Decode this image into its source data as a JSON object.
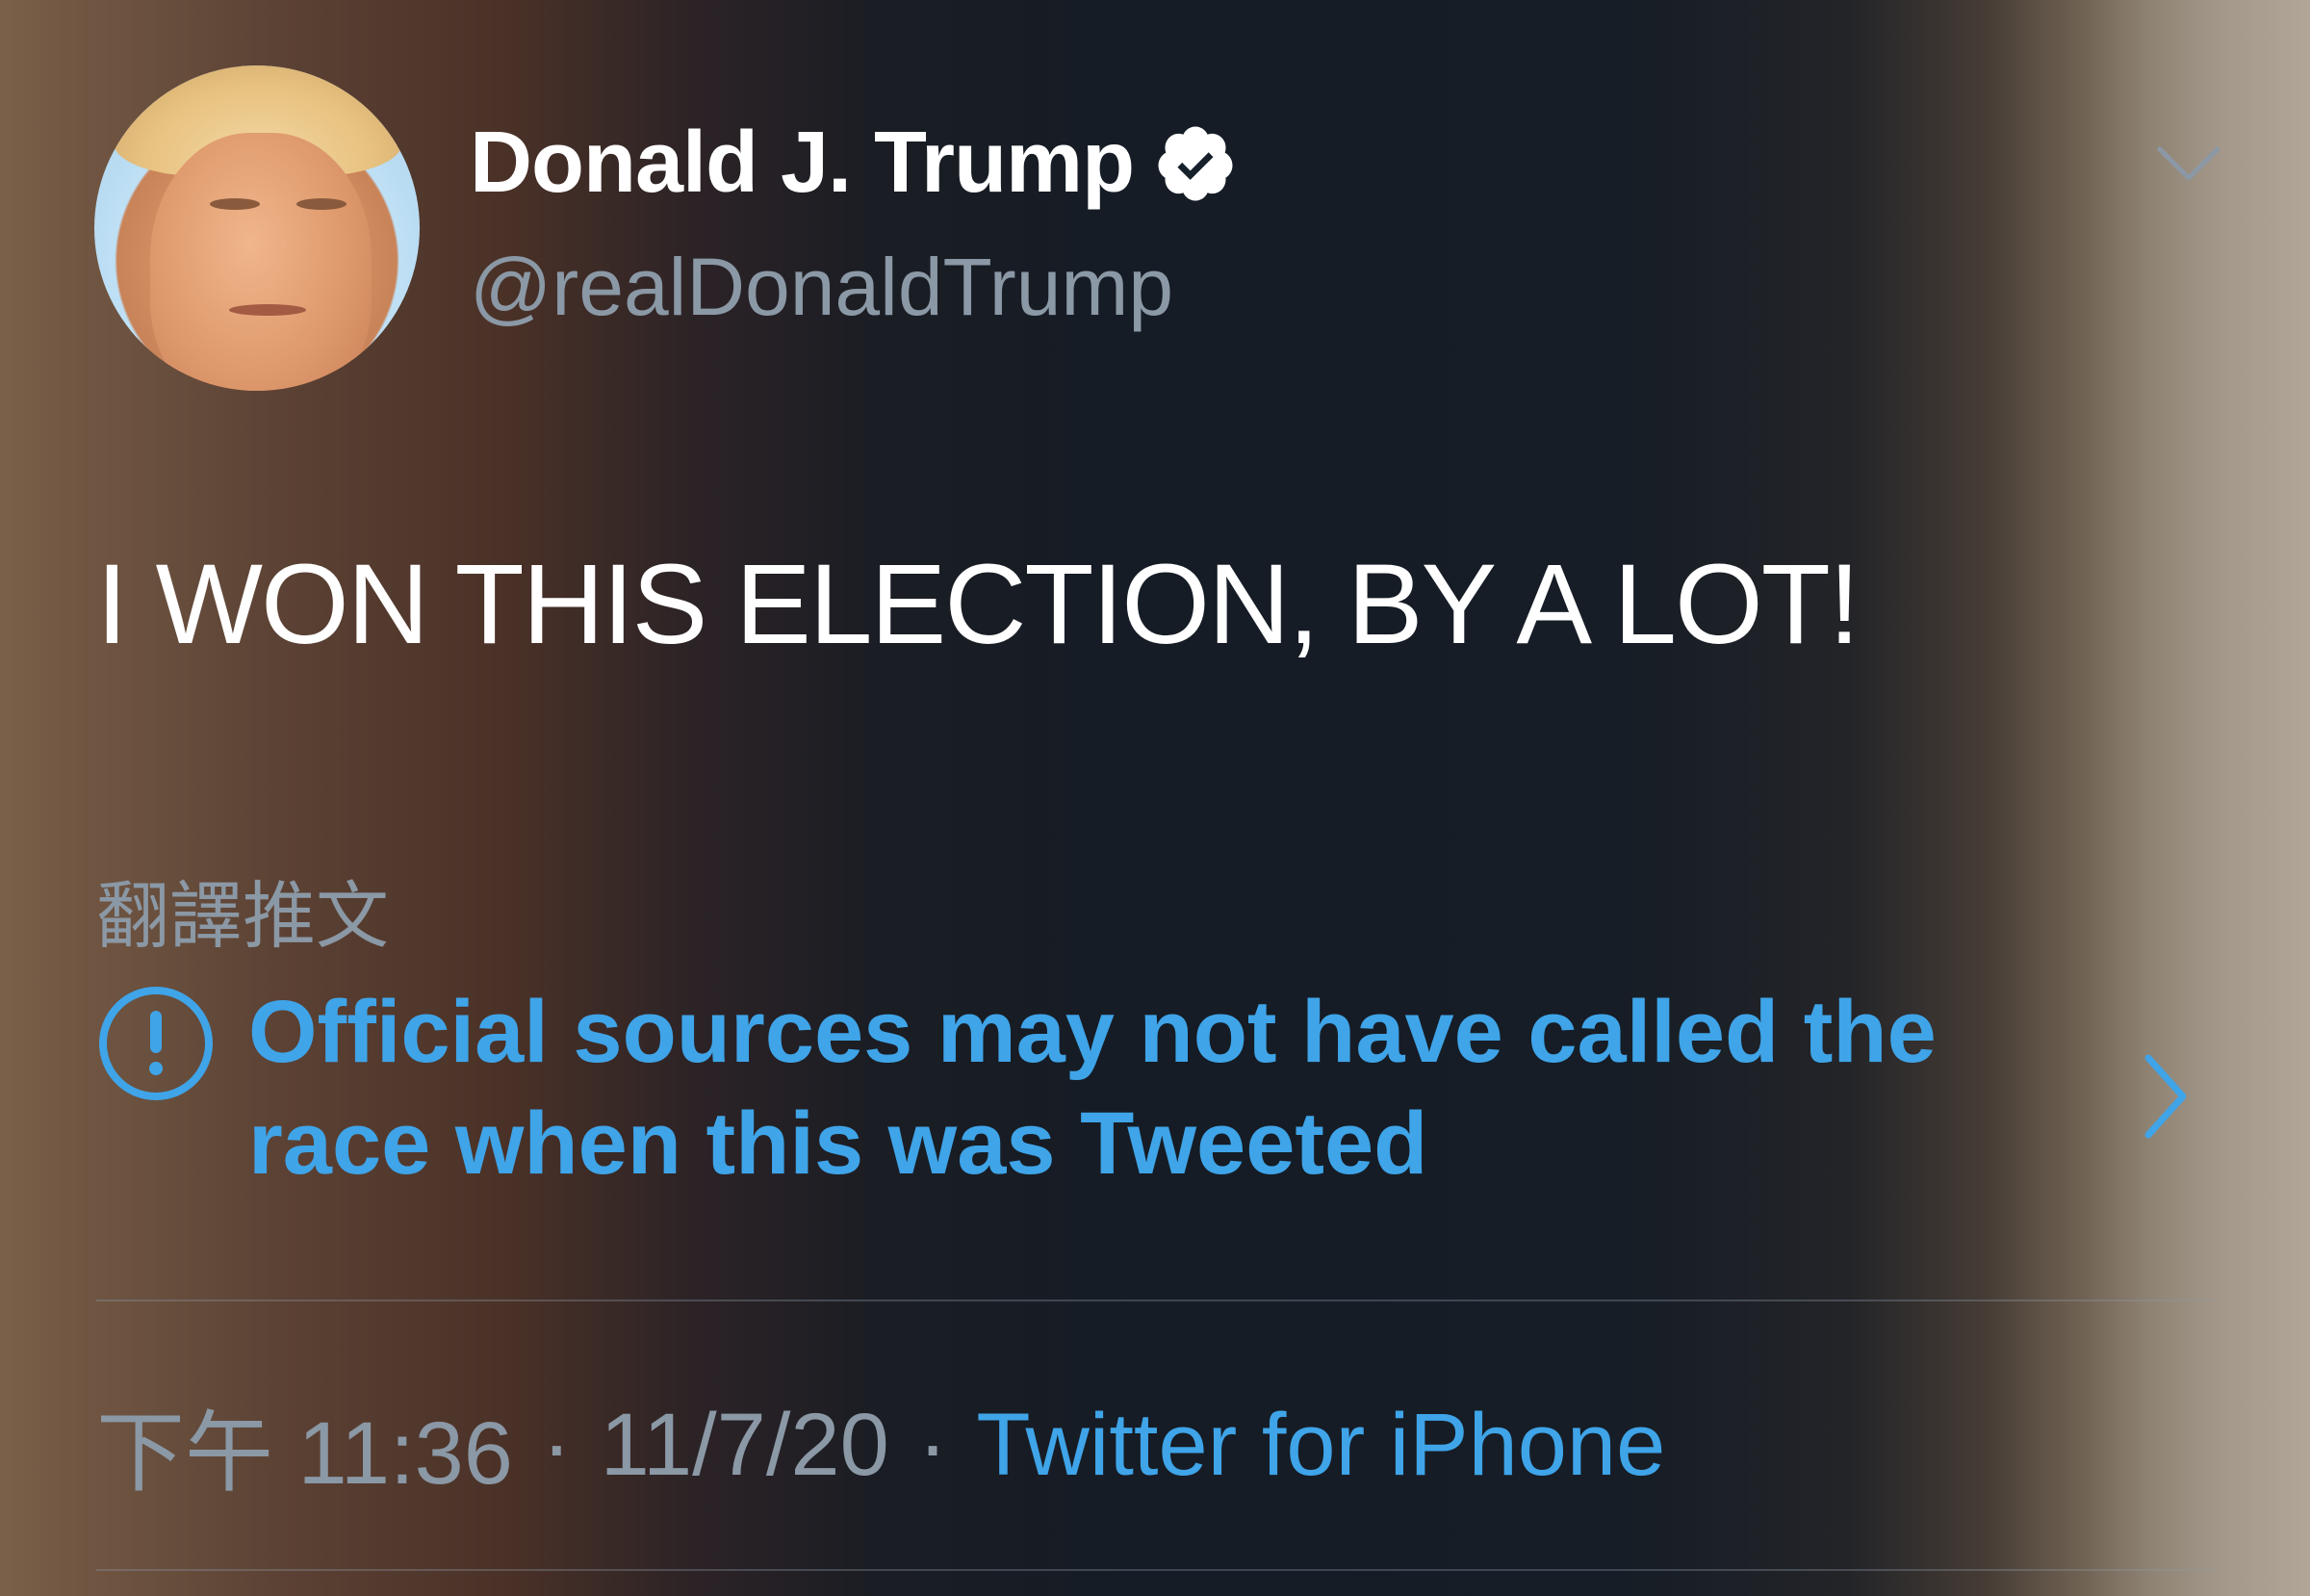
{
  "author": {
    "display_name": "Donald J. Trump",
    "handle": "@realDonaldTrump",
    "verified": true,
    "avatar_icon": "profile-photo"
  },
  "tweet": {
    "text": "I WON THIS ELECTION, BY A LOT!",
    "translate_label": "翻譯推文"
  },
  "notice": {
    "icon": "exclamation-circle-icon",
    "text": "Official sources may not have called the race when this was Tweeted"
  },
  "meta": {
    "time": "下午 11:36",
    "date": "11/7/20",
    "separator": "·",
    "source": "Twitter for iPhone"
  },
  "colors": {
    "background": "#15202b",
    "accent": "#3fa4e8",
    "secondary_text": "#8b98a5",
    "primary_text": "#ffffff"
  }
}
